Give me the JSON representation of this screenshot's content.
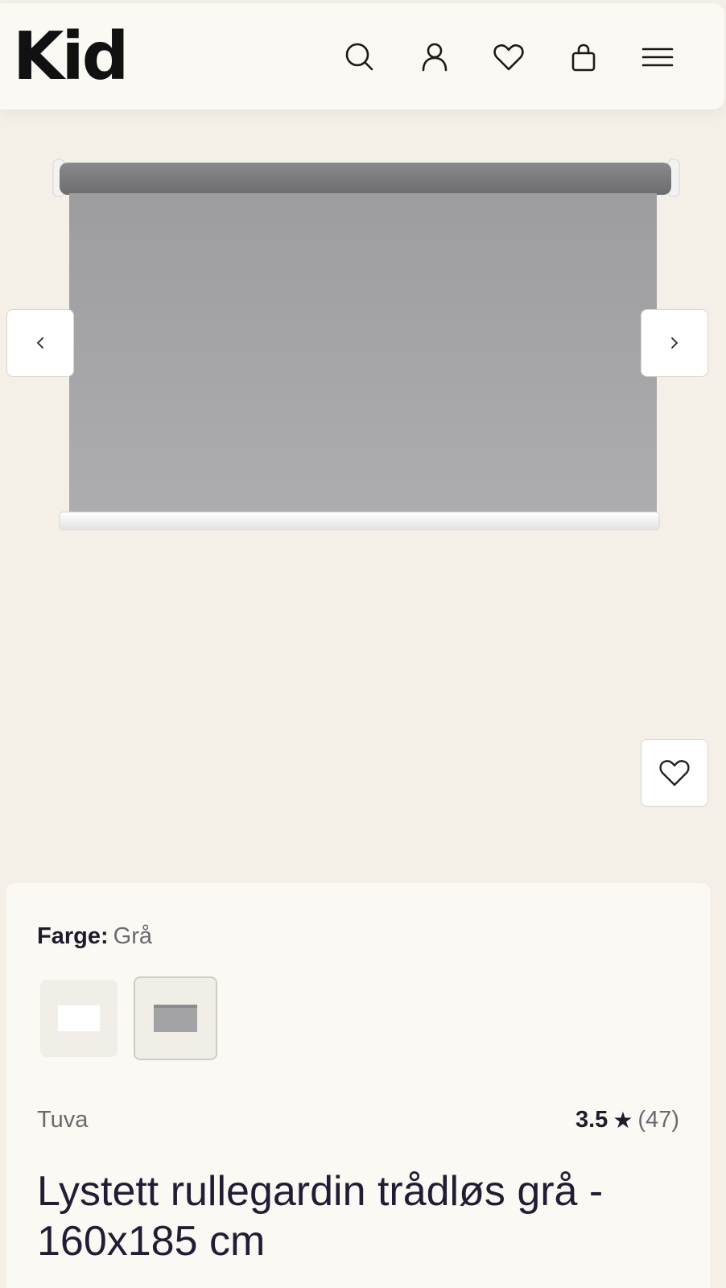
{
  "header": {
    "logo_text": "Kid",
    "icons": [
      "search-icon",
      "account-icon",
      "heart-icon",
      "bag-icon",
      "menu-icon"
    ]
  },
  "gallery": {
    "prev_icon": "chevron-left-icon",
    "next_icon": "chevron-right-icon",
    "favorite_icon": "heart-icon",
    "blind_color": "#a8a8aa",
    "background_color": "#f4f0e8"
  },
  "product": {
    "color_label": "Farge:",
    "color_value": "Grå",
    "swatches": [
      {
        "name": "Hvit",
        "selected": false,
        "color": "#ffffff"
      },
      {
        "name": "Grå",
        "selected": true,
        "color": "#a3a3a6"
      }
    ],
    "brand": "Tuva",
    "rating": "3.5",
    "rating_star": "★",
    "rating_count": "(47)",
    "title": "Lystett rullegardin trådløs grå - 160x185 cm"
  }
}
